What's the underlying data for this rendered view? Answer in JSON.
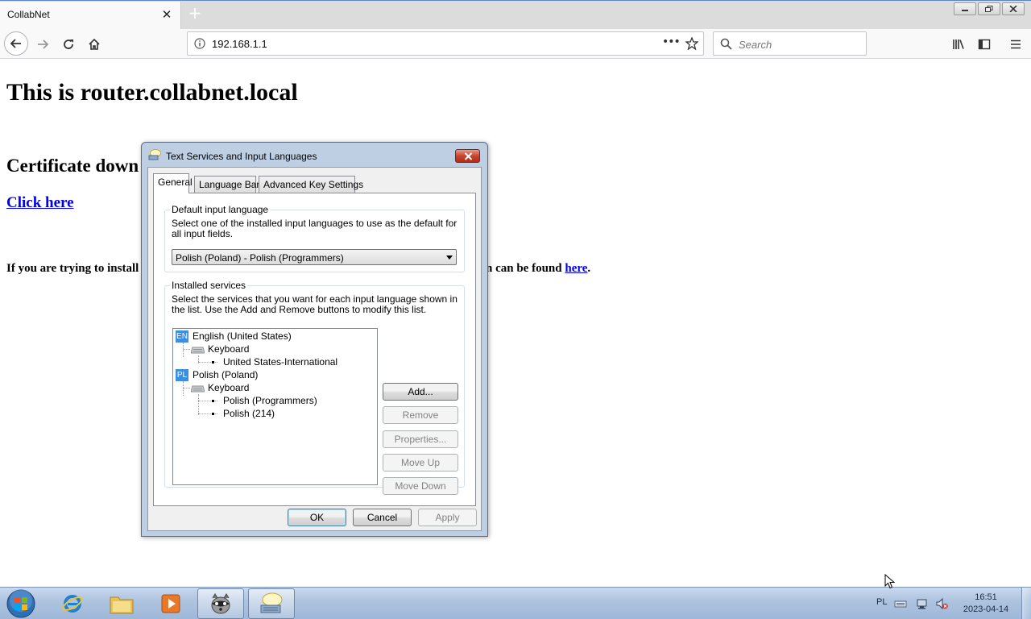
{
  "browser": {
    "tab_title": "CollabNet",
    "url": "192.168.1.1",
    "search_placeholder": "Search",
    "page_actions": "•••"
  },
  "page": {
    "heading": "This is router.collabnet.local",
    "cert_heading": "Certificate down",
    "click_link": "Click here",
    "install_text": "If you are trying to install",
    "install_tail": "n can be found ",
    "here_link": "here",
    "period": "."
  },
  "dialog": {
    "title": "Text Services and Input Languages",
    "tabs": [
      "General",
      "Language Bar",
      "Advanced Key Settings"
    ],
    "default_group": {
      "label": "Default input language",
      "description": "Select one of the installed input languages to use as the default for all input fields.",
      "selected": "Polish (Poland) - Polish (Programmers)"
    },
    "installed_group": {
      "label": "Installed services",
      "description": "Select the services that you want for each input language shown in the list. Use the Add and Remove buttons to modify this list.",
      "tree": {
        "en_badge": "EN",
        "en_lang": "English (United States)",
        "en_keyboard": "Keyboard",
        "en_layout": "United States-International",
        "pl_badge": "PL",
        "pl_lang": "Polish (Poland)",
        "pl_keyboard": "Keyboard",
        "pl_layout_1": "Polish (Programmers)",
        "pl_layout_2": "Polish (214)"
      },
      "buttons": {
        "add": "Add...",
        "remove": "Remove",
        "properties": "Properties...",
        "move_up": "Move Up",
        "move_down": "Move Down"
      }
    },
    "footer": {
      "ok": "OK",
      "cancel": "Cancel",
      "apply": "Apply"
    }
  },
  "taskbar": {
    "language": "PL",
    "time": "16:51",
    "date": "2023-04-14"
  },
  "colors": {
    "link": "#0000ee",
    "dialog_frame": "#bfcfe3",
    "close_button": "#c6452f",
    "language_badge": "#3d8ee0"
  }
}
